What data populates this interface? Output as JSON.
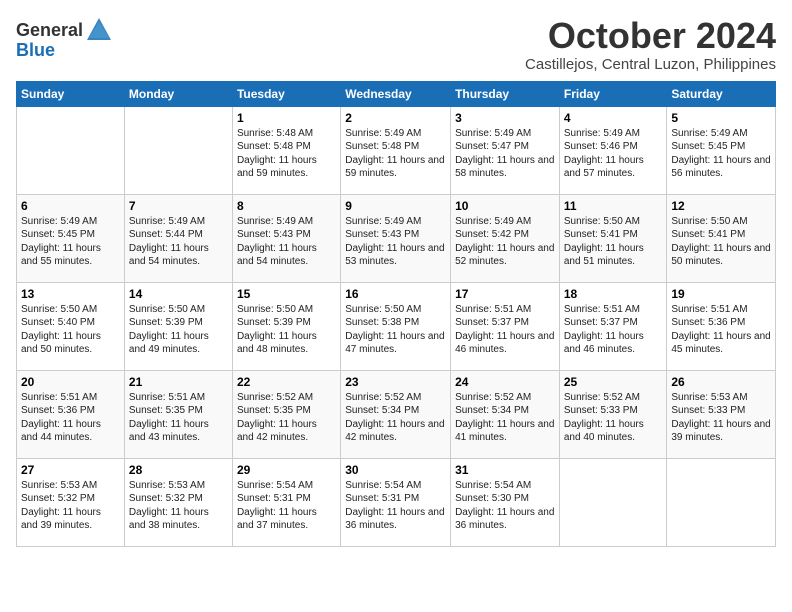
{
  "header": {
    "logo_general": "General",
    "logo_blue": "Blue",
    "month": "October 2024",
    "location": "Castillejos, Central Luzon, Philippines"
  },
  "weekdays": [
    "Sunday",
    "Monday",
    "Tuesday",
    "Wednesday",
    "Thursday",
    "Friday",
    "Saturday"
  ],
  "weeks": [
    [
      {
        "day": "",
        "info": ""
      },
      {
        "day": "",
        "info": ""
      },
      {
        "day": "1",
        "info": "Sunrise: 5:48 AM\nSunset: 5:48 PM\nDaylight: 11 hours and 59 minutes."
      },
      {
        "day": "2",
        "info": "Sunrise: 5:49 AM\nSunset: 5:48 PM\nDaylight: 11 hours and 59 minutes."
      },
      {
        "day": "3",
        "info": "Sunrise: 5:49 AM\nSunset: 5:47 PM\nDaylight: 11 hours and 58 minutes."
      },
      {
        "day": "4",
        "info": "Sunrise: 5:49 AM\nSunset: 5:46 PM\nDaylight: 11 hours and 57 minutes."
      },
      {
        "day": "5",
        "info": "Sunrise: 5:49 AM\nSunset: 5:45 PM\nDaylight: 11 hours and 56 minutes."
      }
    ],
    [
      {
        "day": "6",
        "info": "Sunrise: 5:49 AM\nSunset: 5:45 PM\nDaylight: 11 hours and 55 minutes."
      },
      {
        "day": "7",
        "info": "Sunrise: 5:49 AM\nSunset: 5:44 PM\nDaylight: 11 hours and 54 minutes."
      },
      {
        "day": "8",
        "info": "Sunrise: 5:49 AM\nSunset: 5:43 PM\nDaylight: 11 hours and 54 minutes."
      },
      {
        "day": "9",
        "info": "Sunrise: 5:49 AM\nSunset: 5:43 PM\nDaylight: 11 hours and 53 minutes."
      },
      {
        "day": "10",
        "info": "Sunrise: 5:49 AM\nSunset: 5:42 PM\nDaylight: 11 hours and 52 minutes."
      },
      {
        "day": "11",
        "info": "Sunrise: 5:50 AM\nSunset: 5:41 PM\nDaylight: 11 hours and 51 minutes."
      },
      {
        "day": "12",
        "info": "Sunrise: 5:50 AM\nSunset: 5:41 PM\nDaylight: 11 hours and 50 minutes."
      }
    ],
    [
      {
        "day": "13",
        "info": "Sunrise: 5:50 AM\nSunset: 5:40 PM\nDaylight: 11 hours and 50 minutes."
      },
      {
        "day": "14",
        "info": "Sunrise: 5:50 AM\nSunset: 5:39 PM\nDaylight: 11 hours and 49 minutes."
      },
      {
        "day": "15",
        "info": "Sunrise: 5:50 AM\nSunset: 5:39 PM\nDaylight: 11 hours and 48 minutes."
      },
      {
        "day": "16",
        "info": "Sunrise: 5:50 AM\nSunset: 5:38 PM\nDaylight: 11 hours and 47 minutes."
      },
      {
        "day": "17",
        "info": "Sunrise: 5:51 AM\nSunset: 5:37 PM\nDaylight: 11 hours and 46 minutes."
      },
      {
        "day": "18",
        "info": "Sunrise: 5:51 AM\nSunset: 5:37 PM\nDaylight: 11 hours and 46 minutes."
      },
      {
        "day": "19",
        "info": "Sunrise: 5:51 AM\nSunset: 5:36 PM\nDaylight: 11 hours and 45 minutes."
      }
    ],
    [
      {
        "day": "20",
        "info": "Sunrise: 5:51 AM\nSunset: 5:36 PM\nDaylight: 11 hours and 44 minutes."
      },
      {
        "day": "21",
        "info": "Sunrise: 5:51 AM\nSunset: 5:35 PM\nDaylight: 11 hours and 43 minutes."
      },
      {
        "day": "22",
        "info": "Sunrise: 5:52 AM\nSunset: 5:35 PM\nDaylight: 11 hours and 42 minutes."
      },
      {
        "day": "23",
        "info": "Sunrise: 5:52 AM\nSunset: 5:34 PM\nDaylight: 11 hours and 42 minutes."
      },
      {
        "day": "24",
        "info": "Sunrise: 5:52 AM\nSunset: 5:34 PM\nDaylight: 11 hours and 41 minutes."
      },
      {
        "day": "25",
        "info": "Sunrise: 5:52 AM\nSunset: 5:33 PM\nDaylight: 11 hours and 40 minutes."
      },
      {
        "day": "26",
        "info": "Sunrise: 5:53 AM\nSunset: 5:33 PM\nDaylight: 11 hours and 39 minutes."
      }
    ],
    [
      {
        "day": "27",
        "info": "Sunrise: 5:53 AM\nSunset: 5:32 PM\nDaylight: 11 hours and 39 minutes."
      },
      {
        "day": "28",
        "info": "Sunrise: 5:53 AM\nSunset: 5:32 PM\nDaylight: 11 hours and 38 minutes."
      },
      {
        "day": "29",
        "info": "Sunrise: 5:54 AM\nSunset: 5:31 PM\nDaylight: 11 hours and 37 minutes."
      },
      {
        "day": "30",
        "info": "Sunrise: 5:54 AM\nSunset: 5:31 PM\nDaylight: 11 hours and 36 minutes."
      },
      {
        "day": "31",
        "info": "Sunrise: 5:54 AM\nSunset: 5:30 PM\nDaylight: 11 hours and 36 minutes."
      },
      {
        "day": "",
        "info": ""
      },
      {
        "day": "",
        "info": ""
      }
    ]
  ]
}
